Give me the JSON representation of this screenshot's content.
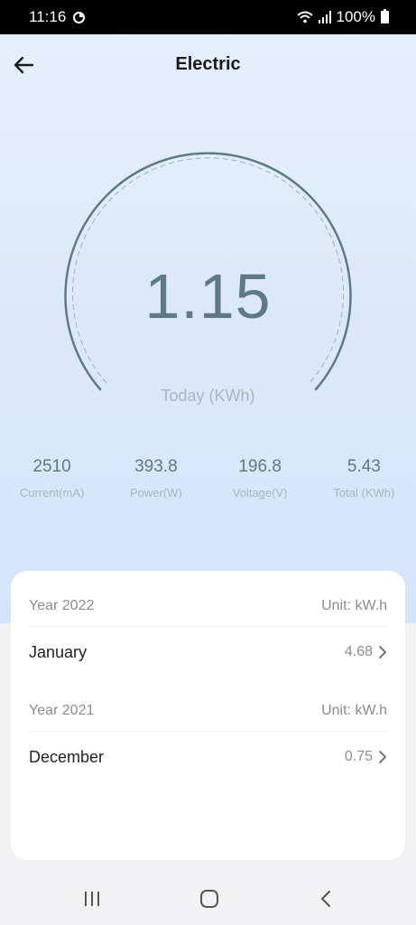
{
  "status": {
    "time": "11:16",
    "battery": "100%"
  },
  "header": {
    "title": "Electric"
  },
  "gauge": {
    "value": "1.15",
    "label": "Today (KWh)"
  },
  "stats": [
    {
      "value": "2510",
      "label": "Current(mA)"
    },
    {
      "value": "393.8",
      "label": "Power(W)"
    },
    {
      "value": "196.8",
      "label": "Voltage(V)"
    },
    {
      "value": "5.43",
      "label": "Total (KWh)"
    }
  ],
  "history": [
    {
      "year": "Year 2022",
      "unit": "Unit: kW.h",
      "month": "January",
      "value": "4.68"
    },
    {
      "year": "Year 2021",
      "unit": "Unit: kW.h",
      "month": "December",
      "value": "0.75"
    }
  ],
  "colors": {
    "accent": "#5e7a86",
    "muted": "#a7b6bf"
  }
}
